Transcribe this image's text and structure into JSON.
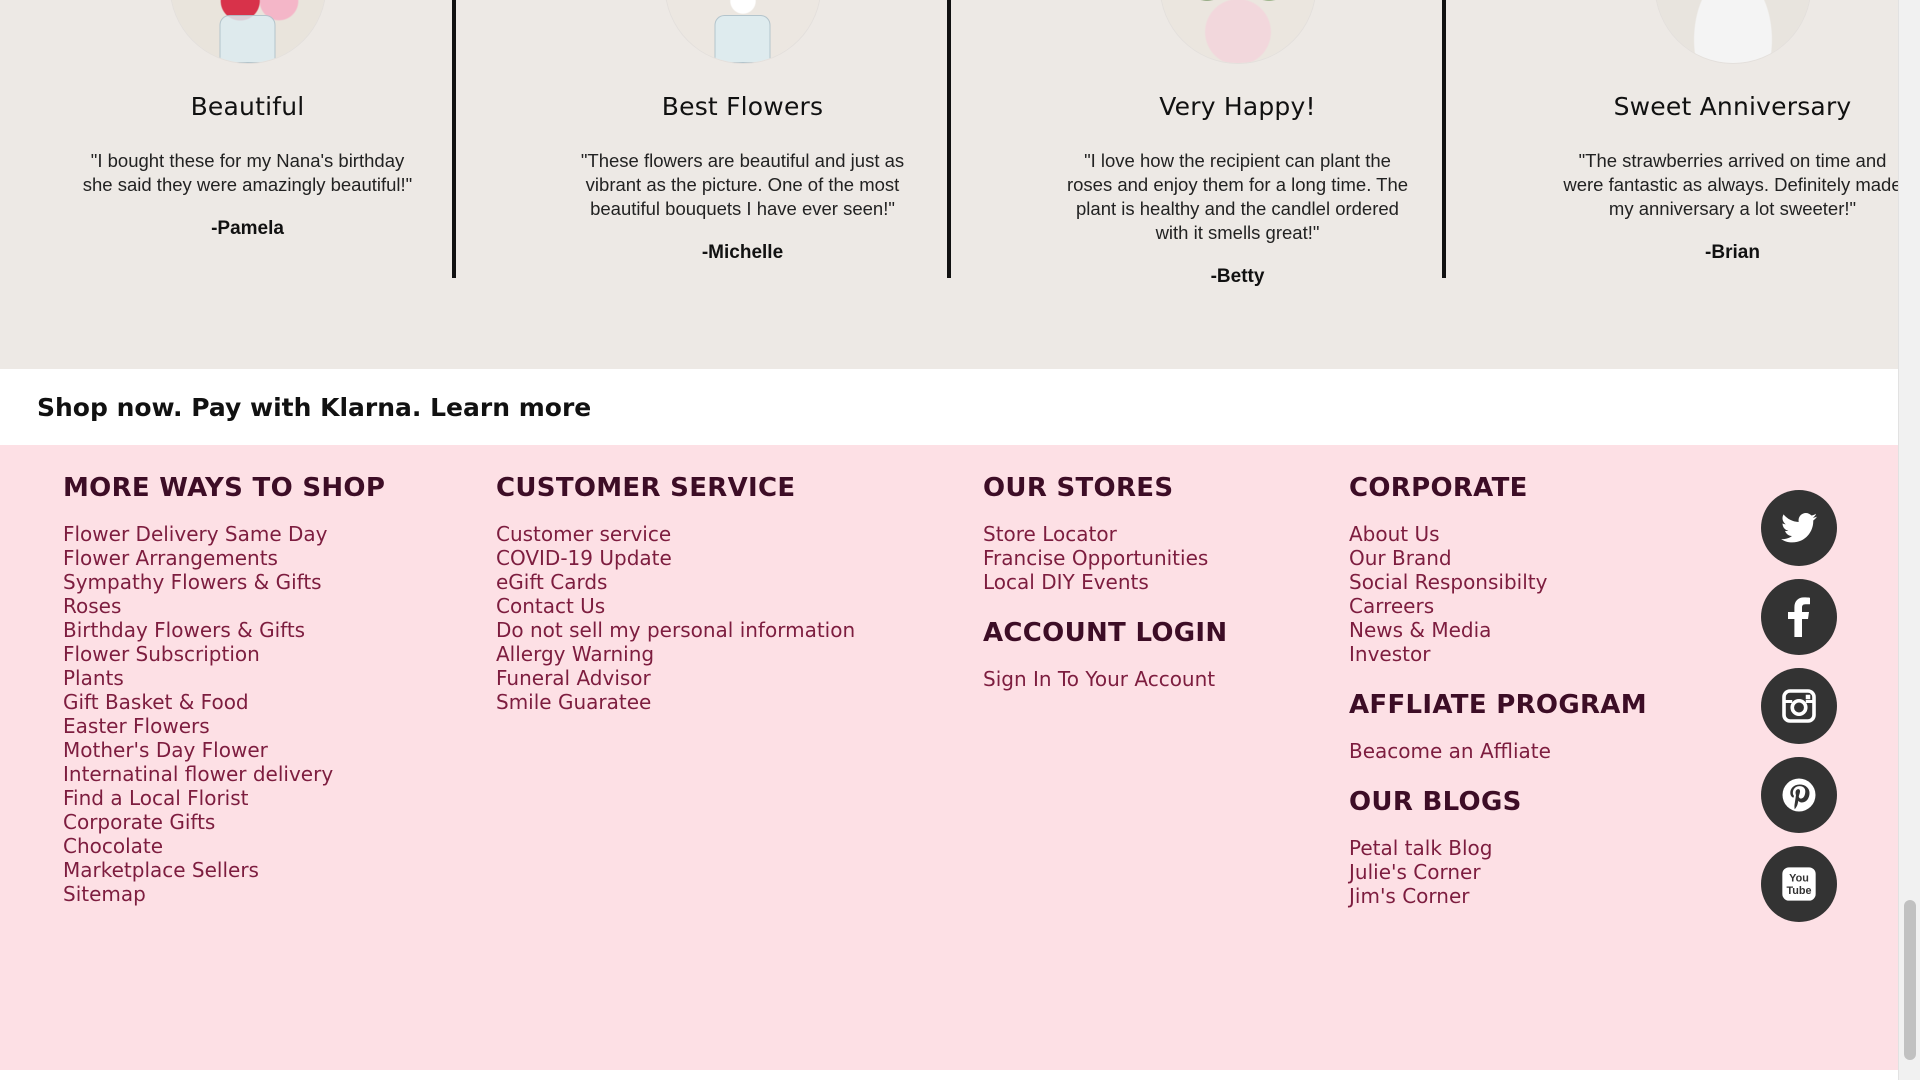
{
  "testimonials": [
    {
      "title": "Beautiful",
      "quote": "\"I bought these for my Nana's birthday she said they were amazingly beautiful!\"",
      "author": "-Pamela",
      "image": "mixed-flower-bouquet"
    },
    {
      "title": "Best Flowers",
      "quote": "\"These flowers are beautiful and just as vibrant as the picture. One of the most beautiful bouquets I have ever seen!\"",
      "author": "-Michelle",
      "image": "blue-flower-bouquet"
    },
    {
      "title": "Very Happy!",
      "quote": "\"I love how the recipient can plant the roses and enjoy them for a long time. The plant is healthy and the candlel ordered with it smells great!\"",
      "author": "-Betty",
      "image": "rose-plant-in-floral-pot"
    },
    {
      "title": "Sweet Anniversary",
      "quote": "\"The strawberries arrived on time and were fantastic as always. Definitely made my anniversary a lot sweeter!\"",
      "author": "-Brian",
      "image": "chocolate-covered-strawberries"
    }
  ],
  "klarna": {
    "text": "Shop now. Pay with Klarna. Learn more"
  },
  "footer": {
    "more_ways": {
      "heading": "MORE WAYS TO SHOP",
      "links": [
        "Flower Delivery Same Day",
        "Flower Arrangements",
        "Sympathy Flowers & Gifts",
        "Roses",
        "Birthday Flowers & Gifts",
        "Flower Subscription",
        "Plants",
        "Gift Basket & Food",
        "Easter Flowers",
        "Mother's Day Flower",
        "Internatinal flower delivery",
        "Find a Local Florist",
        "Corporate Gifts",
        "Chocolate",
        "Marketplace Sellers",
        "Sitemap"
      ]
    },
    "customer_service": {
      "heading": "CUSTOMER SERVICE",
      "links": [
        "Customer service",
        "COVID-19 Update",
        "eGift Cards",
        "Contact Us",
        "Do not sell my personal information",
        "Allergy Warning",
        "Funeral Advisor",
        "Smile Guaratee"
      ]
    },
    "our_stores": {
      "heading": "OUR STORES",
      "links": [
        "Store Locator",
        "Francise Opportunities",
        "Local DIY Events"
      ]
    },
    "account_login": {
      "heading": "ACCOUNT LOGIN",
      "links": [
        "Sign In To Your Account"
      ]
    },
    "corporate": {
      "heading": "CORPORATE",
      "links": [
        "About Us",
        "Our Brand",
        "Social Responsibilty",
        "Carreers",
        "News & Media",
        "Investor"
      ]
    },
    "affiliate": {
      "heading": "AFFLIATE PROGRAM",
      "links": [
        "Beacome an Affliate"
      ]
    },
    "blogs": {
      "heading": "OUR BLOGS",
      "links": [
        "Petal talk Blog",
        "Julie's Corner",
        "Jim's Corner"
      ]
    },
    "social": [
      {
        "name": "twitter-icon",
        "glyph": "🐦"
      },
      {
        "name": "facebook-icon",
        "glyph": "f"
      },
      {
        "name": "instagram-icon",
        "glyph": "◎"
      },
      {
        "name": "pinterest-icon",
        "glyph": "P"
      },
      {
        "name": "youtube-icon",
        "glyph": "You Tube"
      }
    ]
  },
  "colors": {
    "testimonial_bg": "#ede9e5",
    "footer_bg": "#fde0e5",
    "footer_heading": "#3d0d26",
    "footer_link": "#7d1d3f",
    "social_button": "#333333"
  }
}
